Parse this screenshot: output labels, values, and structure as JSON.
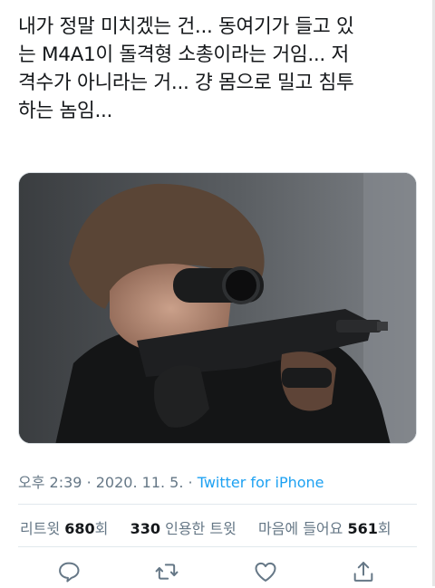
{
  "tweet": {
    "lines": [
      "내가 정말 미치겠는 건... 동여기가 들고 있",
      "는 M4A1이 돌격형 소총이라는 거임... 저",
      "격수가 아니라는 거... 걍 몸으로 밀고 침투",
      "하는 놈임..."
    ]
  },
  "meta": {
    "time": "오후 2:39",
    "sep1": "·",
    "date": "2020. 11. 5.",
    "sep2": "·",
    "source": "Twitter for iPhone"
  },
  "stats": {
    "retweet_label": "리트윗",
    "retweet_count": "680",
    "retweet_suffix": "회",
    "quote_count": "330",
    "quote_label": "인용한 트윗",
    "like_label": "마음에 들어요",
    "like_count": "561",
    "like_suffix": "회"
  },
  "icons": {
    "reply": "reply-icon",
    "retweet": "retweet-icon",
    "like": "heart-icon",
    "share": "share-icon"
  },
  "colors": {
    "text": "#14171a",
    "muted": "#657786",
    "accent": "#1da1f2",
    "divider": "#e1e8ed",
    "icon": "#657786"
  }
}
